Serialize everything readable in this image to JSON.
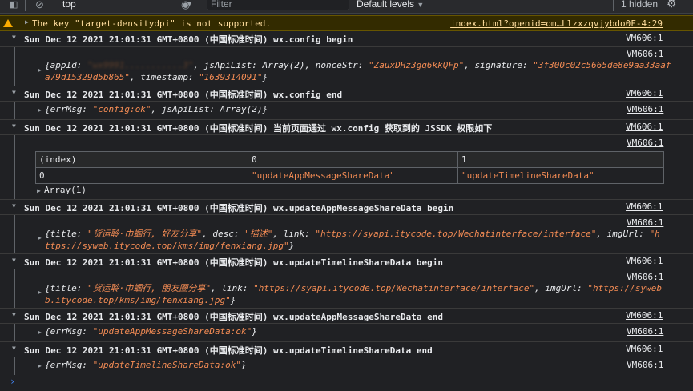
{
  "toolbar": {
    "context": "top",
    "filter_placeholder": "Filter",
    "levels_label": "Default levels",
    "hidden_count": "1 hidden"
  },
  "warning": {
    "text": "The key \"target-densitydpi\" is not supported.",
    "source": "index.html?openid=om…Llzxzqvjybdo0F-4:29"
  },
  "groups": [
    {
      "header": "Sun Dec 12 2021 21:01:31 GMT+0800 (中国标准时间) wx.config begin",
      "source": "VM606:1"
    },
    {
      "header": "Sun Dec 12 2021 21:01:31 GMT+0800 (中国标准时间) wx.config end",
      "source": "VM606:1"
    },
    {
      "header": "Sun Dec 12 2021 21:01:31 GMT+0800 (中国标准时间) 当前页面通过 wx.config 获取到的 JSSDK 权限如下",
      "source": "VM606:1"
    },
    {
      "header": "Sun Dec 12 2021 21:01:31 GMT+0800 (中国标准时间) wx.updateAppMessageShareData begin",
      "source": "VM606:1"
    },
    {
      "header": "Sun Dec 12 2021 21:01:31 GMT+0800 (中国标准时间) wx.updateTimelineShareData begin",
      "source": "VM606:1"
    },
    {
      "header": "Sun Dec 12 2021 21:01:31 GMT+0800 (中国标准时间) wx.updateAppMessageShareData end",
      "source": "VM606:1"
    },
    {
      "header": "Sun Dec 12 2021 21:01:31 GMT+0800 (中国标准时间) wx.updateTimelineShareData end",
      "source": "VM606:1"
    }
  ],
  "logs": {
    "config_begin": {
      "source": "VM606:1",
      "k_appid": "{appId: ",
      "v_appid": "\"wx9991...........3\"",
      "k_jsapi": ", jsApiList: Array(2), nonceStr: ",
      "v_nonce": "\"ZauxDHz3gq6kkQFp\"",
      "k_sig": ", signature: ",
      "v_sig1": "\"3f300c02c5665de8e9aa33aaf",
      "v_sig2": "a79d15329d5b865\"",
      "k_ts": ", timestamp: ",
      "v_ts": "\"1639314091\"",
      "end": "}"
    },
    "config_end": {
      "source": "VM606:1",
      "k_open": "{errMsg: ",
      "v_msg": "\"config:ok\"",
      "k_rest": ", jsApiList: Array(2)}"
    },
    "jssdk_table": {
      "source": "VM606:1",
      "headers": [
        "(index)",
        "0",
        "1"
      ],
      "row_index": "0",
      "row_values": [
        "\"updateAppMessageShareData\"",
        "\"updateTimelineShareData\""
      ],
      "array_label": "Array(1)"
    },
    "app_msg_begin": {
      "source": "VM606:1",
      "k_title": "{title: ",
      "v_title": "\"货运聆·巾蝈行, 好友分享\"",
      "k_desc": ", desc: ",
      "v_desc": "\"描述\"",
      "k_link": ", link: ",
      "v_link": "\"https://syapi.itycode.top/Wechatinterface/interface\"",
      "k_img": ", imgUrl: ",
      "v_img1": "\"h",
      "v_img2": "ttps://syweb.itycode.top/kms/img/fenxiang.jpg\"",
      "end": "}"
    },
    "timeline_begin": {
      "source": "VM606:1",
      "k_title": "{title: ",
      "v_title": "\"货运聆·巾蝈行, 朋友圈分享\"",
      "k_link": ", link: ",
      "v_link": "\"https://syapi.itycode.top/Wechatinterface/interface\"",
      "k_img": ", imgUrl: ",
      "v_img1": "\"https://syweb",
      "v_img2": "b.itycode.top/kms/img/fenxiang.jpg\"",
      "end": "}"
    },
    "app_msg_end": {
      "source": "VM606:1",
      "k_open": "{errMsg: ",
      "v_msg": "\"updateAppMessageShareData:ok\"",
      "end": "}"
    },
    "timeline_end": {
      "source": "VM606:1",
      "k_open": "{errMsg: ",
      "v_msg": "\"updateTimelineShareData:ok\"",
      "end": "}"
    }
  },
  "colors": {
    "background": "#202124",
    "string": "#f28b54",
    "warning_bg": "#332b00",
    "warning_text": "#ffdd9e",
    "prompt": "#4285f4"
  }
}
